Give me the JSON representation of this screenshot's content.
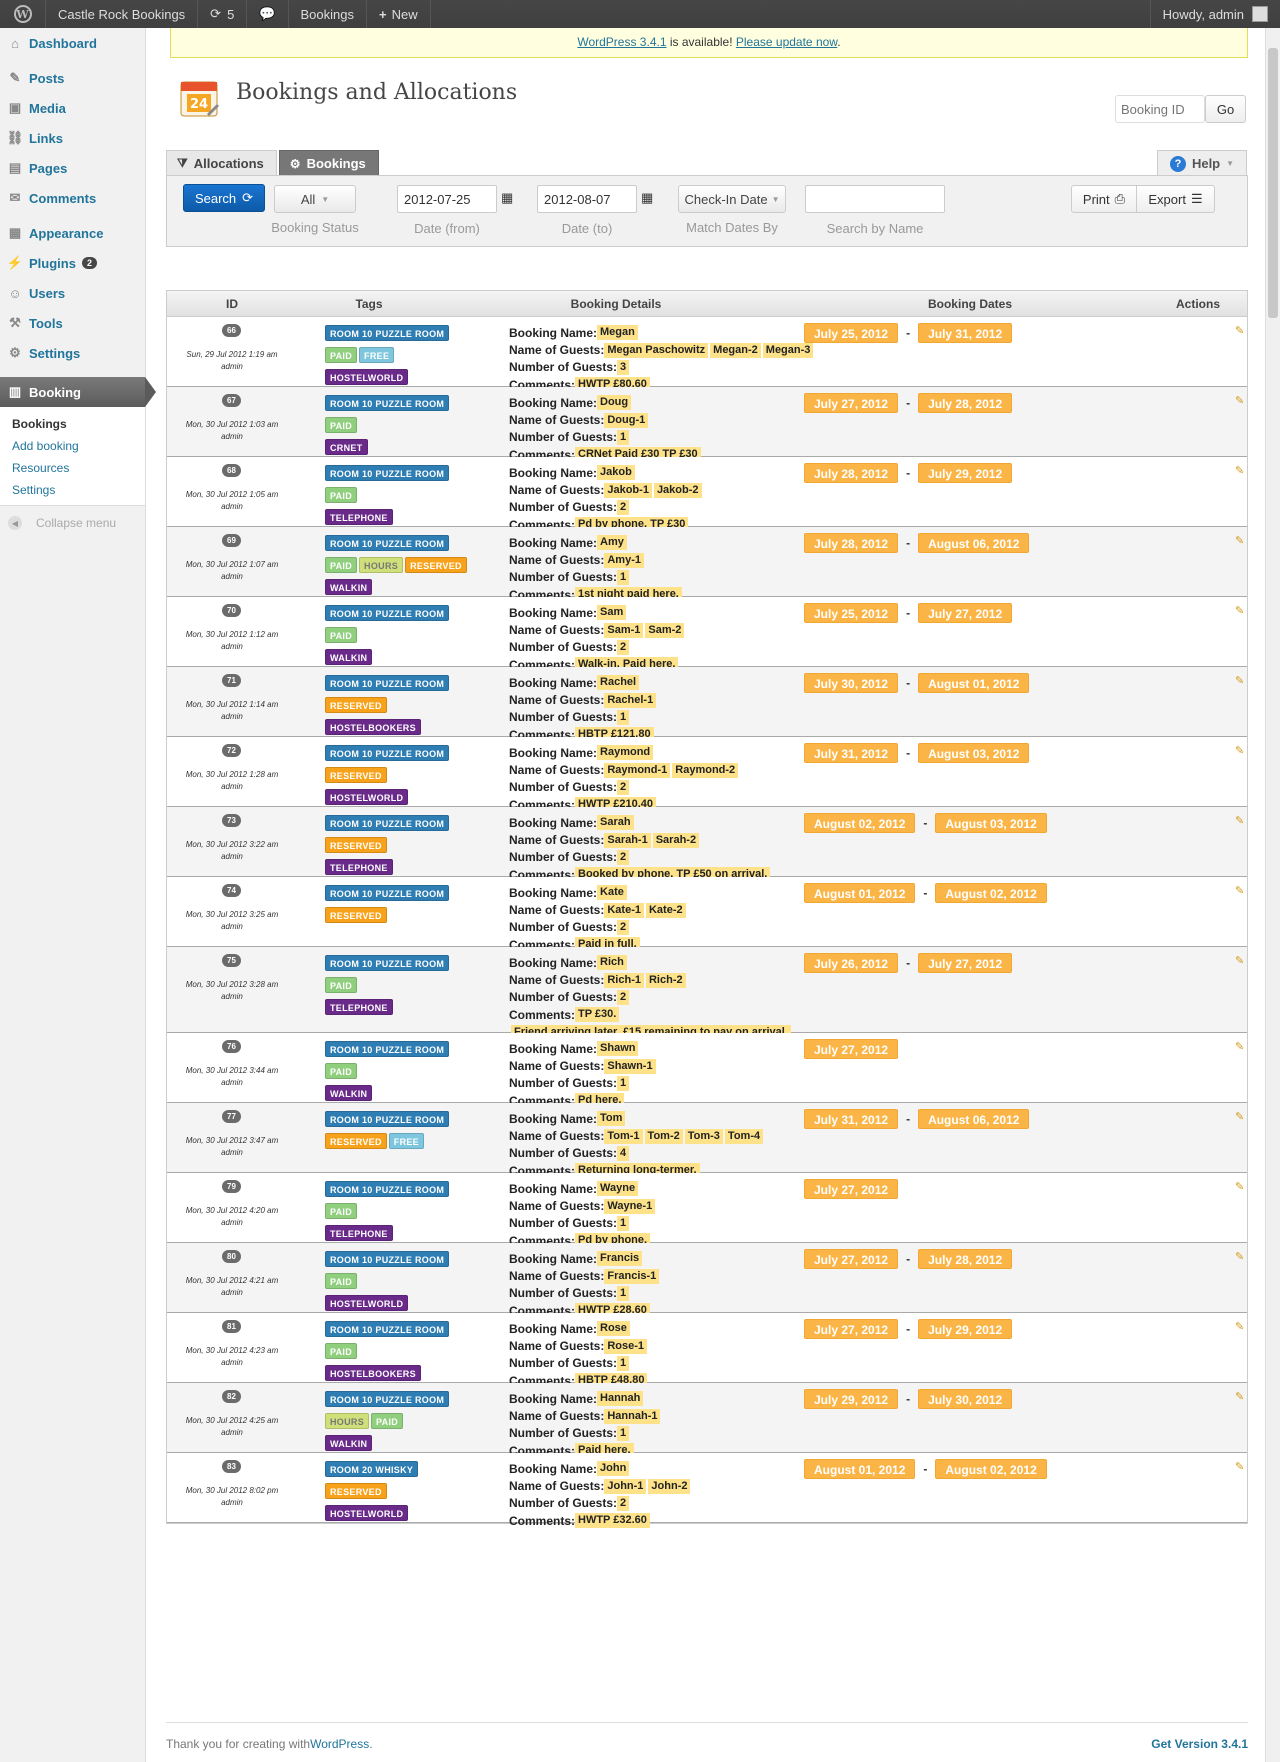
{
  "adminbar": {
    "site": "Castle Rock Bookings",
    "updates": "5",
    "bookings": "Bookings",
    "new": "New",
    "howdy": "Howdy, admin"
  },
  "sidebar": {
    "items": [
      {
        "label": "Dashboard",
        "icon": "home-icon"
      },
      {
        "label": "Posts",
        "icon": "pin-icon"
      },
      {
        "label": "Media",
        "icon": "media-icon"
      },
      {
        "label": "Links",
        "icon": "link-icon"
      },
      {
        "label": "Pages",
        "icon": "pages-icon"
      },
      {
        "label": "Comments",
        "icon": "comments-icon"
      },
      {
        "label": "Appearance",
        "icon": "appearance-icon"
      },
      {
        "label": "Plugins",
        "icon": "plugins-icon",
        "badge": "2"
      },
      {
        "label": "Users",
        "icon": "users-icon"
      },
      {
        "label": "Tools",
        "icon": "tools-icon"
      },
      {
        "label": "Settings",
        "icon": "settings-icon"
      },
      {
        "label": "Booking",
        "icon": "calendar-icon"
      }
    ],
    "submenu": [
      "Bookings",
      "Add booking",
      "Resources",
      "Settings"
    ],
    "collapse": "Collapse menu"
  },
  "notice": {
    "link1": "WordPress 3.4.1",
    "middle": " is available! ",
    "link2": "Please update now",
    "end": "."
  },
  "page": {
    "title": "Bookings and Allocations",
    "booking_id_placeholder": "Booking ID",
    "go": "Go"
  },
  "tabs": {
    "allocations": "Allocations",
    "bookings": "Bookings",
    "help": "Help"
  },
  "filters": {
    "search": "Search",
    "status_value": "All",
    "status_label": "Booking Status",
    "date_from": "2012-07-25",
    "date_from_label": "Date (from)",
    "date_to": "2012-08-07",
    "date_to_label": "Date (to)",
    "match_value": "Check-In Date",
    "match_label": "Match Dates By",
    "name_label": "Search by Name",
    "print": "Print",
    "export": "Export"
  },
  "table": {
    "headers": [
      "ID",
      "Tags",
      "Booking Details",
      "Booking Dates",
      "Actions"
    ],
    "labels": {
      "name": "Booking Name:",
      "guests": "Name of Guests:",
      "count": "Number of Guests:",
      "comments": "Comments:"
    },
    "rows": [
      {
        "id": "66",
        "ts": "Sun, 29 Jul 2012 1:19 am",
        "user": "admin",
        "tags": [
          [
            [
              "ROOM 10 PUZZLE ROOM",
              "room"
            ]
          ],
          [
            [
              "PAID",
              "paid"
            ],
            [
              "FREE",
              "free"
            ]
          ],
          [
            [
              "HOSTELWORLD",
              "src"
            ]
          ]
        ],
        "name": "Megan",
        "guests": [
          "Megan Paschowitz",
          "Megan-2",
          "Megan-3"
        ],
        "count": "3",
        "comments": [
          "HWTP £80.60"
        ],
        "dates": [
          "July 25, 2012",
          "July 31, 2012"
        ]
      },
      {
        "id": "67",
        "ts": "Mon, 30 Jul 2012 1:03 am",
        "user": "admin",
        "tags": [
          [
            [
              "ROOM 10 PUZZLE ROOM",
              "room"
            ]
          ],
          [
            [
              "PAID",
              "paid"
            ]
          ],
          [
            [
              "CRNET",
              "src"
            ]
          ]
        ],
        "name": "Doug",
        "guests": [
          "Doug-1"
        ],
        "count": "1",
        "comments": [
          "CRNet Paid £30 TP £30"
        ],
        "dates": [
          "July 27, 2012",
          "July 28, 2012"
        ]
      },
      {
        "id": "68",
        "ts": "Mon, 30 Jul 2012 1:05 am",
        "user": "admin",
        "tags": [
          [
            [
              "ROOM 10 PUZZLE ROOM",
              "room"
            ]
          ],
          [
            [
              "PAID",
              "paid"
            ]
          ],
          [
            [
              "TELEPHONE",
              "src"
            ]
          ]
        ],
        "name": "Jakob",
        "guests": [
          "Jakob-1",
          "Jakob-2"
        ],
        "count": "2",
        "comments": [
          "Pd by phone. TP £30"
        ],
        "dates": [
          "July 28, 2012",
          "July 29, 2012"
        ]
      },
      {
        "id": "69",
        "ts": "Mon, 30 Jul 2012 1:07 am",
        "user": "admin",
        "tags": [
          [
            [
              "ROOM 10 PUZZLE ROOM",
              "room"
            ]
          ],
          [
            [
              "PAID",
              "paid"
            ],
            [
              "HOURS",
              "hours"
            ],
            [
              "RESERVED",
              "res"
            ]
          ],
          [
            [
              "WALKIN",
              "src"
            ]
          ]
        ],
        "name": "Amy",
        "guests": [
          "Amy-1"
        ],
        "count": "1",
        "comments": [
          "1st night paid here."
        ],
        "dates": [
          "July 28, 2012",
          "August 06, 2012"
        ]
      },
      {
        "id": "70",
        "ts": "Mon, 30 Jul 2012 1:12 am",
        "user": "admin",
        "tags": [
          [
            [
              "ROOM 10 PUZZLE ROOM",
              "room"
            ]
          ],
          [
            [
              "PAID",
              "paid"
            ]
          ],
          [
            [
              "WALKIN",
              "src"
            ]
          ]
        ],
        "name": "Sam",
        "guests": [
          "Sam-1",
          "Sam-2"
        ],
        "count": "2",
        "comments": [
          "Walk-in. Paid here."
        ],
        "dates": [
          "July 25, 2012",
          "July 27, 2012"
        ]
      },
      {
        "id": "71",
        "ts": "Mon, 30 Jul 2012 1:14 am",
        "user": "admin",
        "tags": [
          [
            [
              "ROOM 10 PUZZLE ROOM",
              "room"
            ]
          ],
          [
            [
              "RESERVED",
              "res"
            ]
          ],
          [
            [
              "HOSTELBOOKERS",
              "src"
            ]
          ]
        ],
        "name": "Rachel",
        "guests": [
          "Rachel-1"
        ],
        "count": "1",
        "comments": [
          "HBTP £121.80"
        ],
        "dates": [
          "July 30, 2012",
          "August 01, 2012"
        ]
      },
      {
        "id": "72",
        "ts": "Mon, 30 Jul 2012 1:28 am",
        "user": "admin",
        "tags": [
          [
            [
              "ROOM 10 PUZZLE ROOM",
              "room"
            ]
          ],
          [
            [
              "RESERVED",
              "res"
            ]
          ],
          [
            [
              "HOSTELWORLD",
              "src"
            ]
          ]
        ],
        "name": "Raymond",
        "guests": [
          "Raymond-1",
          "Raymond-2"
        ],
        "count": "2",
        "comments": [
          "HWTP £210.40"
        ],
        "dates": [
          "July 31, 2012",
          "August 03, 2012"
        ]
      },
      {
        "id": "73",
        "ts": "Mon, 30 Jul 2012 3:22 am",
        "user": "admin",
        "tags": [
          [
            [
              "ROOM 10 PUZZLE ROOM",
              "room"
            ]
          ],
          [
            [
              "RESERVED",
              "res"
            ]
          ],
          [
            [
              "TELEPHONE",
              "src"
            ]
          ]
        ],
        "name": "Sarah",
        "guests": [
          "Sarah-1",
          "Sarah-2"
        ],
        "count": "2",
        "comments": [
          "Booked by phone. TP £50 on arrival."
        ],
        "dates": [
          "August 02, 2012",
          "August 03, 2012"
        ]
      },
      {
        "id": "74",
        "ts": "Mon, 30 Jul 2012 3:25 am",
        "user": "admin",
        "tags": [
          [
            [
              "ROOM 10 PUZZLE ROOM",
              "room"
            ]
          ],
          [
            [
              "RESERVED",
              "res"
            ]
          ]
        ],
        "name": "Kate",
        "guests": [
          "Kate-1",
          "Kate-2"
        ],
        "count": "2",
        "comments": [
          "Paid in full."
        ],
        "dates": [
          "August 01, 2012",
          "August 02, 2012"
        ]
      },
      {
        "id": "75",
        "ts": "Mon, 30 Jul 2012 3:28 am",
        "user": "admin",
        "tags": [
          [
            [
              "ROOM 10 PUZZLE ROOM",
              "room"
            ]
          ],
          [
            [
              "PAID",
              "paid"
            ]
          ],
          [
            [
              "TELEPHONE",
              "src"
            ]
          ]
        ],
        "name": "Rich",
        "guests": [
          "Rich-1",
          "Rich-2"
        ],
        "count": "2",
        "comments": [
          "TP £30.",
          "Friend arriving later. £15 remaining to pay on arrival."
        ],
        "dates": [
          "July 26, 2012",
          "July 27, 2012"
        ]
      },
      {
        "id": "76",
        "ts": "Mon, 30 Jul 2012 3:44 am",
        "user": "admin",
        "tags": [
          [
            [
              "ROOM 10 PUZZLE ROOM",
              "room"
            ]
          ],
          [
            [
              "PAID",
              "paid"
            ]
          ],
          [
            [
              "WALKIN",
              "src"
            ]
          ]
        ],
        "name": "Shawn",
        "guests": [
          "Shawn-1"
        ],
        "count": "1",
        "comments": [
          "Pd here."
        ],
        "dates": [
          "July 27, 2012"
        ]
      },
      {
        "id": "77",
        "ts": "Mon, 30 Jul 2012 3:47 am",
        "user": "admin",
        "tags": [
          [
            [
              "ROOM 10 PUZZLE ROOM",
              "room"
            ]
          ],
          [
            [
              "RESERVED",
              "res"
            ],
            [
              "FREE",
              "free"
            ]
          ]
        ],
        "name": "Tom",
        "guests": [
          "Tom-1",
          "Tom-2",
          "Tom-3",
          "Tom-4"
        ],
        "count": "4",
        "comments": [
          "Returning long-termer."
        ],
        "dates": [
          "July 31, 2012",
          "August 06, 2012"
        ]
      },
      {
        "id": "79",
        "ts": "Mon, 30 Jul 2012 4:20 am",
        "user": "admin",
        "tags": [
          [
            [
              "ROOM 10 PUZZLE ROOM",
              "room"
            ]
          ],
          [
            [
              "PAID",
              "paid"
            ]
          ],
          [
            [
              "TELEPHONE",
              "src"
            ]
          ]
        ],
        "name": "Wayne",
        "guests": [
          "Wayne-1"
        ],
        "count": "1",
        "comments": [
          "Pd by phone."
        ],
        "dates": [
          "July 27, 2012"
        ]
      },
      {
        "id": "80",
        "ts": "Mon, 30 Jul 2012 4:21 am",
        "user": "admin",
        "tags": [
          [
            [
              "ROOM 10 PUZZLE ROOM",
              "room"
            ]
          ],
          [
            [
              "PAID",
              "paid"
            ]
          ],
          [
            [
              "HOSTELWORLD",
              "src"
            ]
          ]
        ],
        "name": "Francis",
        "guests": [
          "Francis-1"
        ],
        "count": "1",
        "comments": [
          "HWTP £28.60"
        ],
        "dates": [
          "July 27, 2012",
          "July 28, 2012"
        ]
      },
      {
        "id": "81",
        "ts": "Mon, 30 Jul 2012 4:23 am",
        "user": "admin",
        "tags": [
          [
            [
              "ROOM 10 PUZZLE ROOM",
              "room"
            ]
          ],
          [
            [
              "PAID",
              "paid"
            ]
          ],
          [
            [
              "HOSTELBOOKERS",
              "src"
            ]
          ]
        ],
        "name": "Rose",
        "guests": [
          "Rose-1"
        ],
        "count": "1",
        "comments": [
          "HBTP £48.80"
        ],
        "dates": [
          "July 27, 2012",
          "July 29, 2012"
        ]
      },
      {
        "id": "82",
        "ts": "Mon, 30 Jul 2012 4:25 am",
        "user": "admin",
        "tags": [
          [
            [
              "ROOM 10 PUZZLE ROOM",
              "room"
            ]
          ],
          [
            [
              "HOURS",
              "hours"
            ],
            [
              "PAID",
              "paid"
            ]
          ],
          [
            [
              "WALKIN",
              "src"
            ]
          ]
        ],
        "name": "Hannah",
        "guests": [
          "Hannah-1"
        ],
        "count": "1",
        "comments": [
          "Paid here."
        ],
        "dates": [
          "July 29, 2012",
          "July 30, 2012"
        ]
      },
      {
        "id": "83",
        "ts": "Mon, 30 Jul 2012 8:02 pm",
        "user": "admin",
        "tags": [
          [
            [
              "ROOM 20 WHISKY",
              "room"
            ]
          ],
          [
            [
              "RESERVED",
              "res"
            ]
          ],
          [
            [
              "HOSTELWORLD",
              "src"
            ]
          ]
        ],
        "name": "John",
        "guests": [
          "John-1",
          "John-2"
        ],
        "count": "2",
        "comments": [
          "HWTP £32.60"
        ],
        "dates": [
          "August 01, 2012",
          "August 02, 2012"
        ]
      }
    ]
  },
  "footer": {
    "text": "Thank you for creating with ",
    "link": "WordPress",
    "end": ".",
    "version": "Get Version 3.4.1"
  }
}
